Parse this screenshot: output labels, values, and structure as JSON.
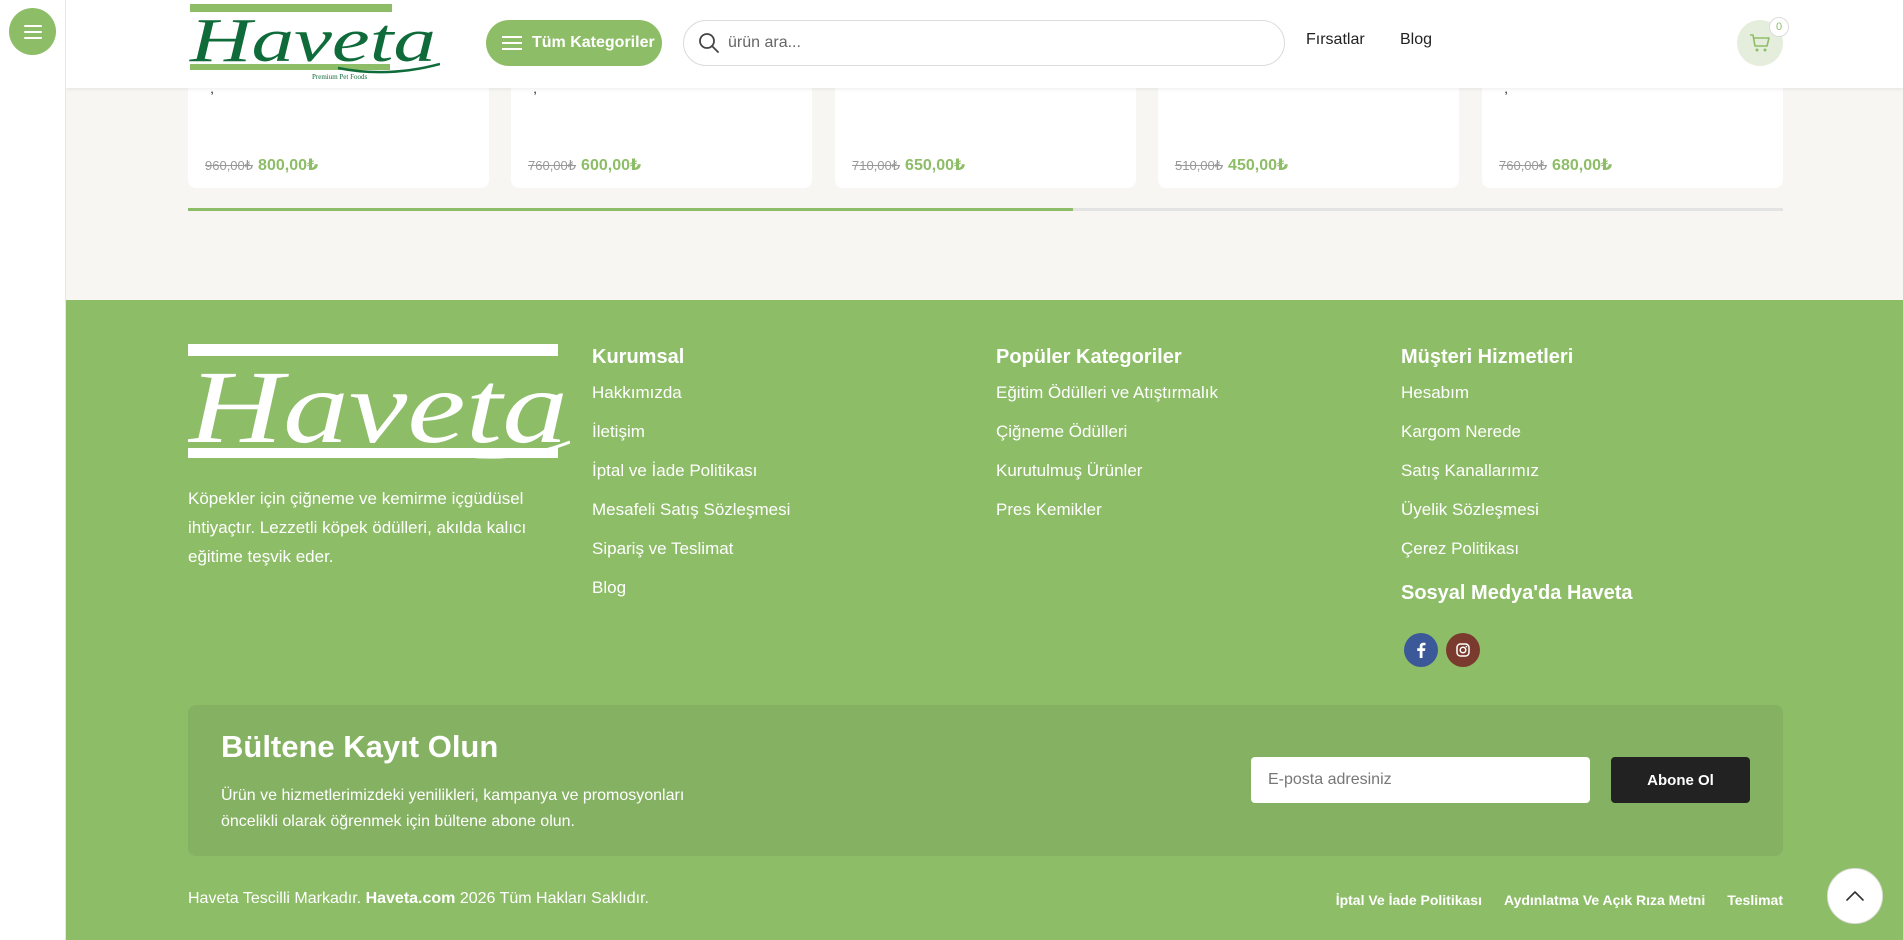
{
  "header": {
    "brand": "Haveta",
    "brand_tagline": "Premium Pet Foods",
    "categories_button": "Tüm Kategoriler",
    "search_placeholder": "ürün ara...",
    "nav": [
      "Fırsatlar",
      "Blog"
    ],
    "cart_count": "0"
  },
  "products": [
    {
      "old_price": "960,00₺",
      "price": "800,00₺"
    },
    {
      "old_price": "760,00₺",
      "price": "600,00₺"
    },
    {
      "old_price": "710,00₺",
      "price": "650,00₺"
    },
    {
      "old_price": "510,00₺",
      "price": "450,00₺"
    },
    {
      "old_price": "760,00₺",
      "price": "680,00₺"
    }
  ],
  "carousel_progress": 0.555,
  "footer": {
    "brand": "Haveta",
    "description": "Köpekler için çiğneme ve kemirme içgüdüsel ihtiyaçtır. Lezzetli köpek ödülleri, akılda kalıcı eğitime teşvik eder.",
    "columns": [
      {
        "title": "Kurumsal",
        "links": [
          "Hakkımızda",
          "İletişim",
          "İptal ve İade Politikası",
          "Mesafeli Satış Sözleşmesi",
          "Sipariş ve Teslimat",
          "Blog"
        ]
      },
      {
        "title": "Popüler Kategoriler",
        "links": [
          "Eğitim Ödülleri ve Atıştırmalık",
          "Çiğneme Ödülleri",
          "Kurutulmuş Ürünler",
          "Pres Kemikler"
        ]
      },
      {
        "title": "Müşteri Hizmetleri",
        "links": [
          "Hesabım",
          "Kargom Nerede",
          "Satış Kanallarımız",
          "Üyelik Sözleşmesi",
          "Çerez Politikası"
        ]
      }
    ],
    "social_title": "Sosyal Medya'da Haveta",
    "social": [
      {
        "icon": "facebook-icon",
        "color": "#3b5998"
      },
      {
        "icon": "instagram-icon",
        "color": "#7b3a2e"
      }
    ],
    "newsletter": {
      "title": "Bültene Kayıt Olun",
      "text": "Ürün ve hizmetlerimizdeki yenilikleri, kampanya ve promosyonları öncelikli olarak öğrenmek için bültene abone olun.",
      "email_placeholder": "E-posta adresiniz",
      "button": "Abone Ol"
    },
    "copyright_prefix": "Haveta Tescilli Markadır.",
    "copyright_domain": "Haveta.com",
    "copyright_suffix": "2026 Tüm Hakları Saklıdır.",
    "bottom_links": [
      "İptal Ve İade Politikası",
      "Aydınlatma Ve Açık Rıza Metni",
      "Teslimat"
    ]
  },
  "colors": {
    "accent": "#8ebd68",
    "brand_dark": "#0f6b3a",
    "newsletter_bg": "#85b162",
    "dark_button": "#222222"
  }
}
